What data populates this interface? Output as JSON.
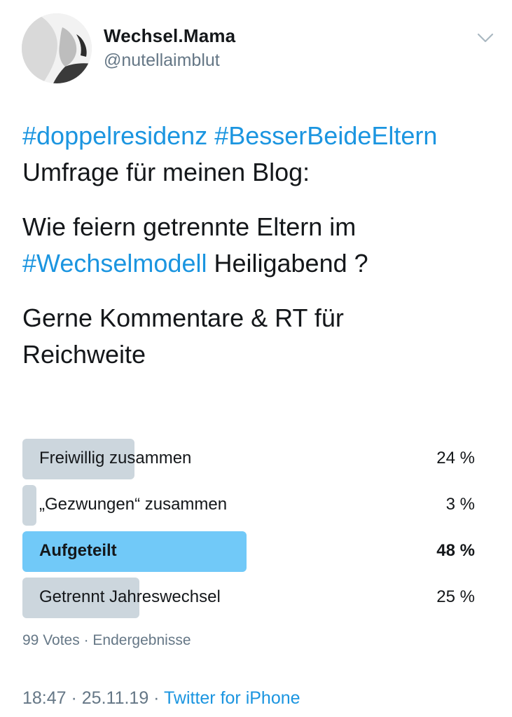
{
  "header": {
    "display_name": "Wechsel.Mama",
    "handle": "@nutellaimblut",
    "avatar_icon": "profile-photo-avatar",
    "menu_icon": "chevron-down-icon"
  },
  "tweet": {
    "line1_hashtag1": "#doppelresidenz",
    "line1_hashtag2": "#BesserBeideEltern",
    "line2": " Umfrage für meinen Blog:",
    "line3": "Wie feiern getrennte Eltern im",
    "line4_hashtag": "#Wechselmodell",
    "line4_rest": " Heiligabend ?",
    "line5": "Gerne Kommentare & RT für",
    "line6": "Reichweite"
  },
  "poll": {
    "options": [
      {
        "label": "Freiwillig zusammen",
        "percent_text": "24 %",
        "percent": 24,
        "winner": false
      },
      {
        "label": "„Gezwungen“ zusammen",
        "percent_text": "3 %",
        "percent": 3,
        "winner": false
      },
      {
        "label": "Aufgeteilt",
        "percent_text": "48 %",
        "percent": 48,
        "winner": true
      },
      {
        "label": "Getrennt Jahreswechsel",
        "percent_text": "25 %",
        "percent": 25,
        "winner": false
      }
    ],
    "meta": "99 Votes · Endergebnisse"
  },
  "footer": {
    "time": "18:47 · 25.11.19 · ",
    "source": "Twitter for iPhone"
  },
  "colors": {
    "link": "#1b95e0",
    "bar_default": "#ccd6dd",
    "bar_winner": "#71c9f8",
    "secondary_text": "#657786"
  }
}
